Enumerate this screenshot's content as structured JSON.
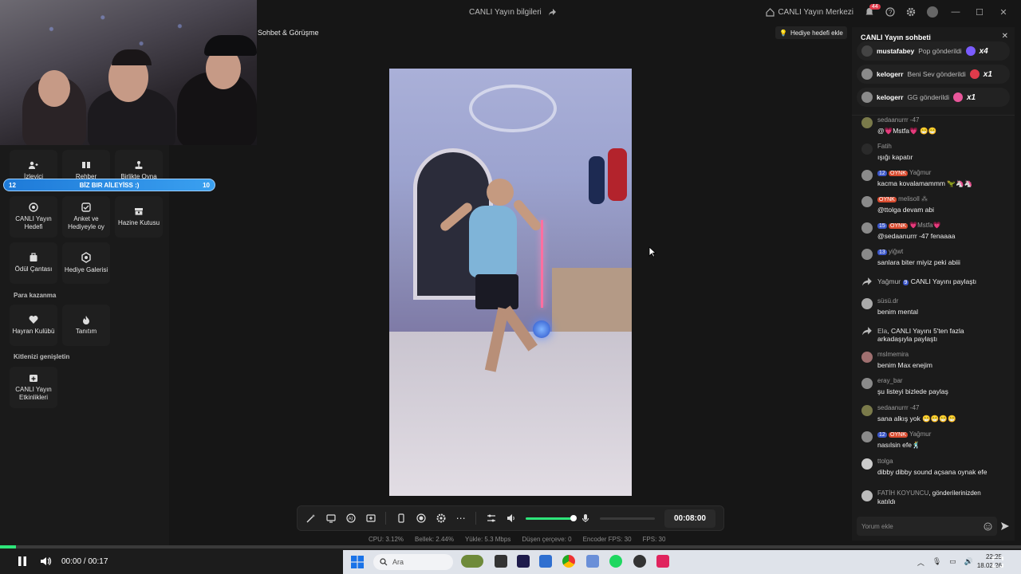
{
  "titlebar": {
    "stream_info": "CANLI Yayın bilgileri",
    "live_center": "CANLI Yayın Merkezi",
    "notif_count": "44"
  },
  "sidebar": {
    "chat_call_label": "Sohbet & Görüşme",
    "tiles_row1": [
      "İzleyici",
      "Rehber",
      "Birlikte Oyna"
    ],
    "aile_bar": {
      "left": "12",
      "label": "BİZ BIR AİLEYİSS :)",
      "right": "10"
    },
    "tiles_row2": [
      "CANLI Yayın Hedefi",
      "Anket ve Hediyeyle oy",
      "Hazine Kutusu"
    ],
    "tiles_row3": [
      "Ödül Çantası",
      "Hediye Galerisi"
    ],
    "section_earn": "Para kazanma",
    "tiles_row4": [
      "Hayran Kulübü",
      "Tanıtım"
    ],
    "section_audience": "Kitlenizi genişletin",
    "tiles_row5": [
      "CANLI Yayın Etkinlikleri"
    ]
  },
  "center": {
    "gift_goal": "Hediye hedefi ekle",
    "timer": "00:08:00",
    "stats": [
      "CPU: 3.12%",
      "Bellek: 2.44%",
      "Yükle: 5.3 Mbps",
      "Düşen çerçeve: 0",
      "Encoder FPS: 30",
      "FPS: 30"
    ]
  },
  "chat": {
    "title": "CANLI Yayın sohbeti",
    "gifts": [
      {
        "user": "mustafabey",
        "text": "Pop gönderildi",
        "mult": "x4",
        "color": "#7a5cff"
      },
      {
        "user": "kelogerr",
        "text": "Beni Sev gönderildi",
        "mult": "x1",
        "color": "#e03b4b"
      },
      {
        "user": "kelogerr",
        "text": "GG gönderildi",
        "mult": "x1",
        "color": "#e8569a"
      }
    ],
    "messages": [
      {
        "name": "sedaanurrr -47",
        "text": "@💗Mstfa💗 😁😁"
      },
      {
        "name": "Fatih",
        "text": "ışığı kapatır"
      },
      {
        "name_pre": "12",
        "name_tag": "OYNK",
        "name": "Yağmur",
        "text": "kacma kovalamammm 🦖🦄🦄"
      },
      {
        "name_tag": "OYNK",
        "name": "melisoll ⁂",
        "text": "@ttolga devam abi"
      },
      {
        "name_pre": "15",
        "name_tag": "OYNK",
        "name": "💗Mstfa💗",
        "text": "@sedaanurrr -47 fenaaaa"
      },
      {
        "name_pre": "13",
        "name": "yiğwt",
        "text": "sanlara biter miyiz peki abiii"
      },
      {
        "system": "Yağmur",
        "sys_pre": "9",
        "sys_text": "CANLI Yayını paylaştı"
      },
      {
        "name": "süsü.dr",
        "text": "benim mental"
      },
      {
        "system": "Ela",
        "sys_text": ", CANLI Yayını 5'ten fazla",
        "sys_text2": "arkadaşıyla paylaştı"
      },
      {
        "name": "mslmemira",
        "text": "benim Max enejim"
      },
      {
        "name": "eray_bar",
        "text": "şu listeyi bizlede paylaş"
      },
      {
        "name": "sedaanurrr -47",
        "text": "sana alkış yok 😁😁😁😁"
      },
      {
        "name_pre": "12",
        "name_tag": "OYNK",
        "name": "Yağmur",
        "text": "nasılsin efe🕺"
      },
      {
        "name": "ttolga",
        "text": "dibby dibby sound açsana oynak efe"
      },
      {
        "name": "FATİH KOYUNCU",
        "name_extra": ", gönderilerinizden",
        "text": "katıldı"
      }
    ],
    "comment_placeholder": "Yorum ekle"
  },
  "player": {
    "time": "00:00 / 00:17",
    "progress": 0.016
  },
  "taskbar": {
    "search": "Ara",
    "clock_time": "22:25",
    "clock_date": "18.02.26"
  }
}
